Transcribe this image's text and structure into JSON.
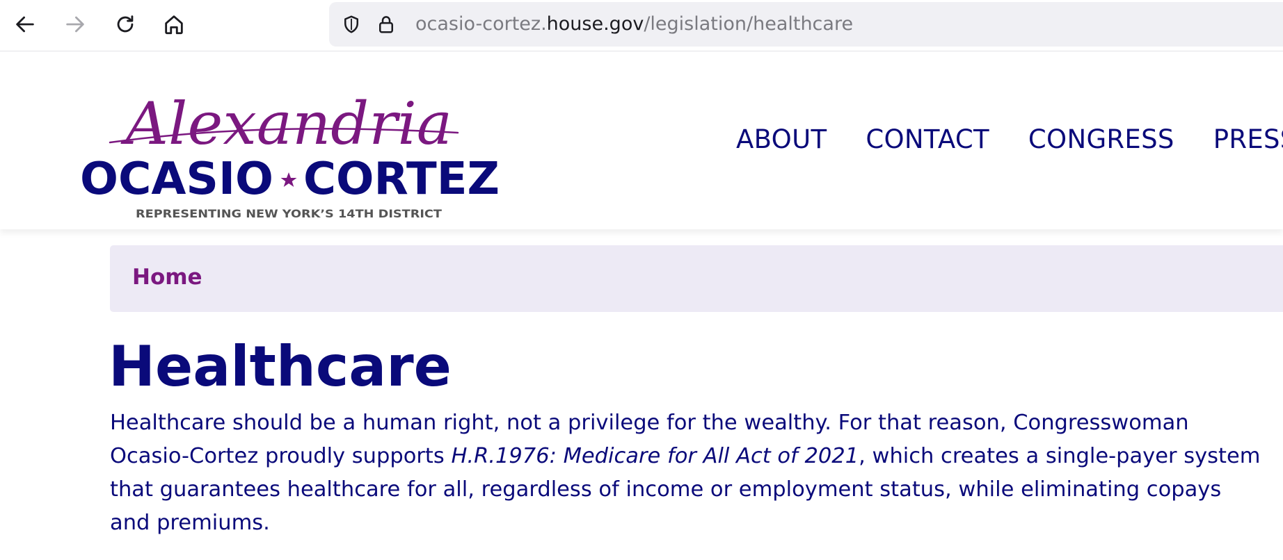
{
  "browser": {
    "url_prefix": "ocasio-cortez.",
    "url_domain": "house.gov",
    "url_path": "/legislation/healthcare",
    "icons": [
      "back-arrow-icon",
      "forward-arrow-icon",
      "reload-icon",
      "home-icon",
      "shield-icon",
      "lock-icon"
    ]
  },
  "logo": {
    "script_name": "Alexandria",
    "name_left": "OCASIO",
    "name_right": "CORTEZ",
    "tagline": "REPRESENTING NEW YORK’S 14TH DISTRICT"
  },
  "nav": {
    "items": [
      {
        "label": "ABOUT"
      },
      {
        "label": "CONTACT"
      },
      {
        "label": "CONGRESS"
      },
      {
        "label": "PRESS"
      }
    ]
  },
  "breadcrumb": {
    "home": "Home"
  },
  "page": {
    "title": "Healthcare",
    "intro_before": "Healthcare should be a human right, not a privilege for the wealthy. For that reason, Congresswoman Ocasio-Cortez proudly supports ",
    "intro_bill": "H.R.1976: Medicare for All Act of 2021",
    "intro_after": ", which creates a single-payer system that guarantees healthcare for all, regardless of income or employment status, while eliminating copays and premiums."
  },
  "colors": {
    "navy": "#0a0a7a",
    "purple": "#7b1880",
    "breadcrumb_bg": "#edeaf5",
    "tagline": "#555555"
  }
}
